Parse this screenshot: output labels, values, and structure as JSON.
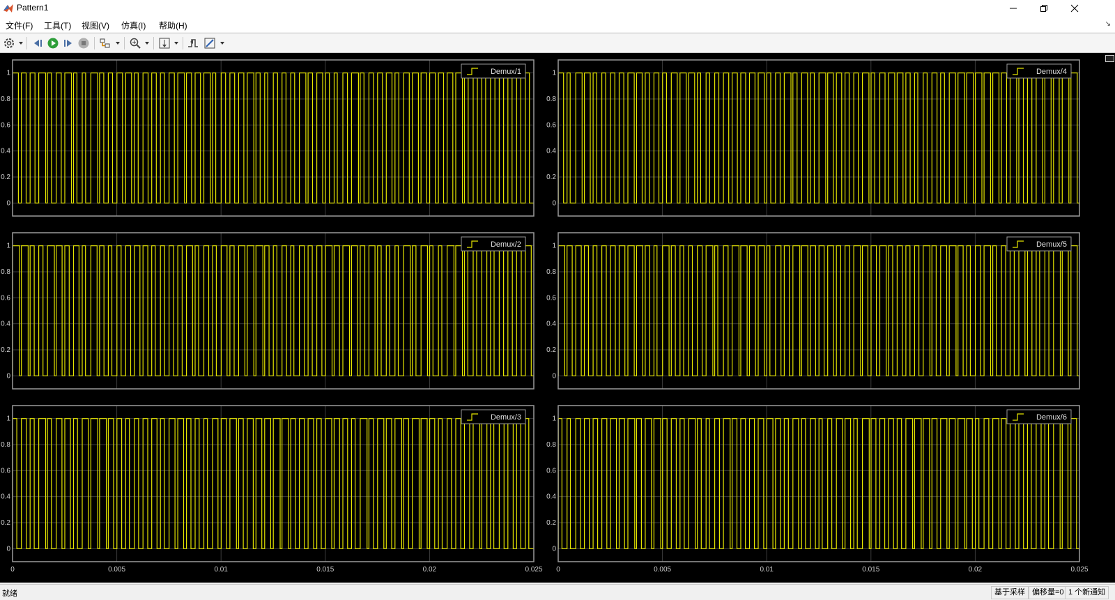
{
  "window": {
    "title": "Pattern1"
  },
  "menu": {
    "items": [
      "文件(F)",
      "工具(T)",
      "视图(V)",
      "仿真(I)",
      "帮助(H)"
    ]
  },
  "toolbar": {
    "icons": [
      "settings-icon",
      "step-back-icon",
      "run-icon",
      "step-forward-icon",
      "stop-icon",
      "highlight-block-icon",
      "zoom-in-icon",
      "scale-axes-icon",
      "triggers-icon",
      "measurements-icon"
    ]
  },
  "colors": {
    "plot_bg": "#000000",
    "axes_border": "#9a9a9a",
    "grid": "#3c3c3c",
    "signal": "#e6e600",
    "tick_label": "#d0d0d0"
  },
  "plots": [
    {
      "legend": "Demux/1"
    },
    {
      "legend": "Demux/2"
    },
    {
      "legend": "Demux/3"
    },
    {
      "legend": "Demux/4"
    },
    {
      "legend": "Demux/5"
    },
    {
      "legend": "Demux/6"
    }
  ],
  "axes": {
    "y_ticks": [
      "0",
      "0.2",
      "0.4",
      "0.6",
      "0.8",
      "1"
    ],
    "x_ticks": [
      "0",
      "0.005",
      "0.01",
      "0.015",
      "0.02",
      "0.025"
    ]
  },
  "chart_data": {
    "type": "line",
    "layout": "3x2",
    "xlim": [
      0,
      0.025
    ],
    "ylim": [
      -0.1,
      1.1
    ],
    "grid": true,
    "legend_position": "top-right",
    "series": [
      {
        "name": "Demux/1",
        "pulses": 60
      },
      {
        "name": "Demux/2",
        "pulses": 60
      },
      {
        "name": "Demux/3",
        "pulses": 60
      },
      {
        "name": "Demux/4",
        "pulses": 60
      },
      {
        "name": "Demux/5",
        "pulses": 60
      },
      {
        "name": "Demux/6",
        "pulses": 60
      }
    ]
  },
  "status": {
    "left": "就绪",
    "sampling": "基于采样",
    "offset": "偏移量=0",
    "notification": "1 个新通知"
  }
}
